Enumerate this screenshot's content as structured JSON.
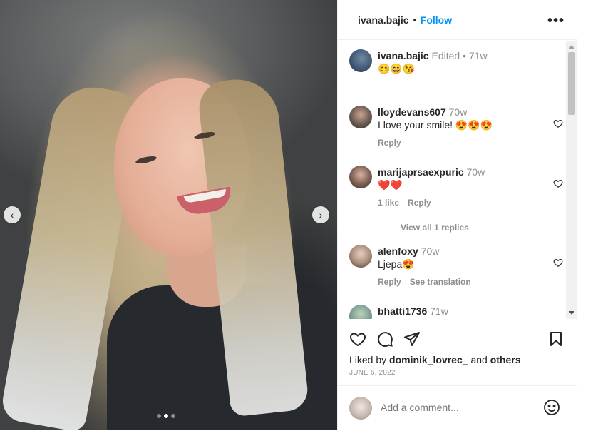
{
  "post": {
    "username": "ivana.bajic",
    "follow_label": "Follow",
    "separator": "•",
    "more_label": "•••"
  },
  "photo": {
    "carousel_dots": 3,
    "active_dot": 1,
    "prev_label": "‹",
    "next_label": "›"
  },
  "caption": {
    "username": "ivana.bajic",
    "edited": "Edited",
    "dot": "•",
    "time": "71w",
    "text": "😊😄😘"
  },
  "comments": [
    {
      "username": "lloydevans607",
      "time": "70w",
      "text": "I love your smile! 😍😍😍",
      "reply_label": "Reply"
    },
    {
      "username": "marijaprsaexpuric",
      "time": "70w",
      "text": "❤️❤️",
      "likes_label": "1 like",
      "reply_label": "Reply"
    },
    {
      "username": "alenfoxy",
      "time": "70w",
      "text": "Ljepa😍",
      "reply_label": "Reply",
      "translate_label": "See translation"
    },
    {
      "username": "bhatti1736",
      "time": "71w"
    }
  ],
  "view_replies_label": "View all 1 replies",
  "engagement": {
    "liked_by_prefix": "Liked by",
    "liked_by_user": "dominik_lovrec_",
    "and_label": "and",
    "others_label": "others",
    "date": "JUNE 6, 2022"
  },
  "add_comment": {
    "placeholder": "Add a comment..."
  },
  "colors": {
    "accent": "#0095f6",
    "muted": "#8e8e8e",
    "text": "#262626"
  }
}
